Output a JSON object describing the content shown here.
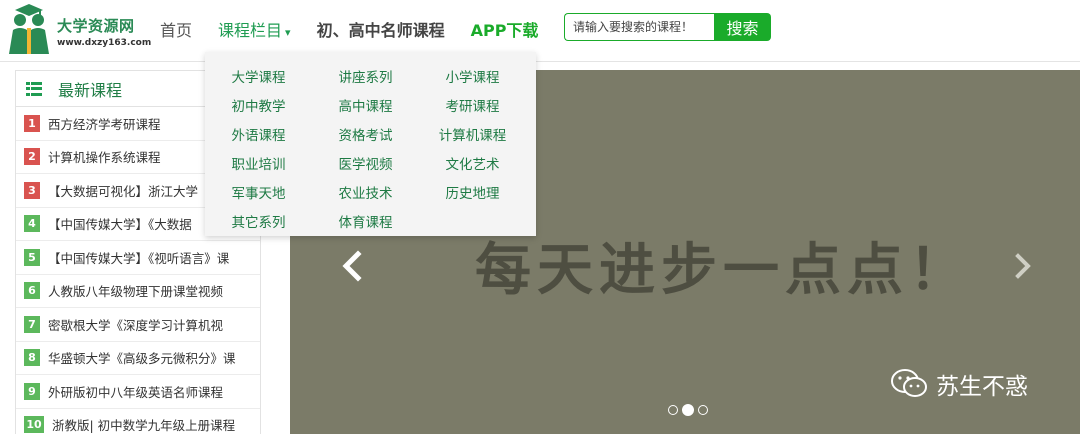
{
  "header": {
    "logo": {
      "name": "大学资源网",
      "url": "www.dxzy163.com"
    },
    "nav": [
      {
        "label": "首页"
      },
      {
        "label": "课程栏目",
        "caret": "▾"
      },
      {
        "label": "初、高中名师课程"
      },
      {
        "label": "APP下载"
      }
    ],
    "search": {
      "placeholder": "请输入要搜索的课程！",
      "button": "搜索"
    }
  },
  "dropdown": {
    "items": [
      "大学课程",
      "讲座系列",
      "小学课程",
      "初中教学",
      "高中课程",
      "考研课程",
      "外语课程",
      "资格考试",
      "计算机课程",
      "职业培训",
      "医学视频",
      "文化艺术",
      "军事天地",
      "农业技术",
      "历史地理",
      "其它系列",
      "体育课程"
    ]
  },
  "sidebar": {
    "title": "最新课程",
    "courses": [
      {
        "num": "1",
        "text": "西方经济学考研课程"
      },
      {
        "num": "2",
        "text": "计算机操作系统课程"
      },
      {
        "num": "3",
        "text": "【大数据可视化】浙江大学"
      },
      {
        "num": "4",
        "text": "【中国传媒大学】《大数据"
      },
      {
        "num": "5",
        "text": "【中国传媒大学】《视听语言》课"
      },
      {
        "num": "6",
        "text": "人教版八年级物理下册课堂视频"
      },
      {
        "num": "7",
        "text": "密歇根大学《深度学习计算机视"
      },
      {
        "num": "8",
        "text": "华盛顿大学《高级多元微积分》课"
      },
      {
        "num": "9",
        "text": "外研版初中八年级英语名师课程"
      },
      {
        "num": "10",
        "text": "浙教版| 初中数学九年级上册课程"
      }
    ]
  },
  "banner": {
    "slogan": "每天进步一点点！",
    "active_slide": 2,
    "slide_count": 3,
    "watermark": "苏生不惑"
  },
  "colors": {
    "brand_green": "#1aab2a",
    "nav_green": "#1f9c52",
    "banner_bg": "#7b7b68",
    "badge_red": "#d9534f",
    "badge_green": "#5cb85c"
  },
  "icons": {
    "sidebar": "list-icon",
    "prev": "chevron-left-icon",
    "next": "chevron-right-icon",
    "watermark": "wechat-icon"
  }
}
